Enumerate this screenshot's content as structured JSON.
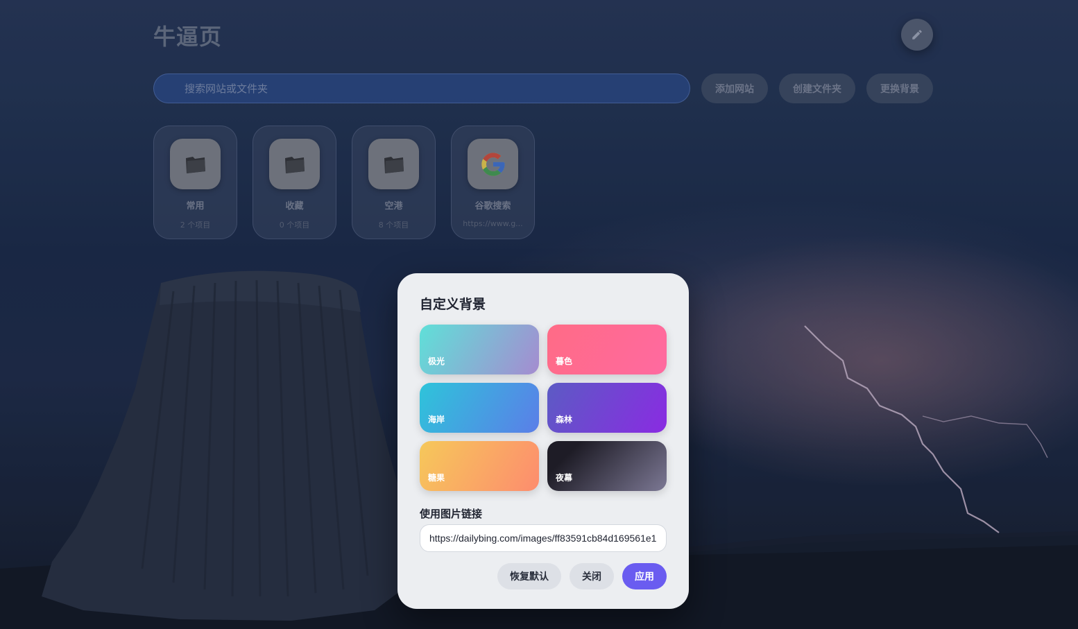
{
  "app": {
    "title": "牛逼页"
  },
  "search": {
    "placeholder": "搜索网站或文件夹"
  },
  "toolbar": {
    "add_site": "添加网站",
    "create_folder": "创建文件夹",
    "change_background": "更换背景",
    "edit_icon": "pencil-icon"
  },
  "tiles": [
    {
      "name": "常用",
      "subtitle": "2 个项目",
      "icon": "folder-icon"
    },
    {
      "name": "收藏",
      "subtitle": "0 个项目",
      "icon": "folder-icon"
    },
    {
      "name": "空港",
      "subtitle": "8 个项目",
      "icon": "folder-icon"
    },
    {
      "name": "谷歌搜索",
      "subtitle": "https://www.g...",
      "icon": "google-icon"
    }
  ],
  "modal": {
    "title": "自定义背景",
    "presets": [
      {
        "label": "极光",
        "colors": [
          "#5fe0d8",
          "#a58bd0"
        ]
      },
      {
        "label": "暮色",
        "colors": [
          "#ff6b86",
          "#ff6aa0"
        ]
      },
      {
        "label": "海岸",
        "colors": [
          "#2ec4da",
          "#5b7ee8"
        ]
      },
      {
        "label": "森林",
        "colors": [
          "#5c5bc4",
          "#8a2be2"
        ]
      },
      {
        "label": "糖果",
        "colors": [
          "#f6c85a",
          "#fd8c6e"
        ]
      },
      {
        "label": "夜幕",
        "colors": [
          "#23202c",
          "#7c7894"
        ]
      }
    ],
    "url_label": "使用图片链接",
    "url_value": "https://dailybing.com/images/ff83591cb84d169561e1",
    "buttons": {
      "reset": "恢复默认",
      "close": "关闭",
      "apply": "应用"
    },
    "accent": "#6a5cf0"
  }
}
